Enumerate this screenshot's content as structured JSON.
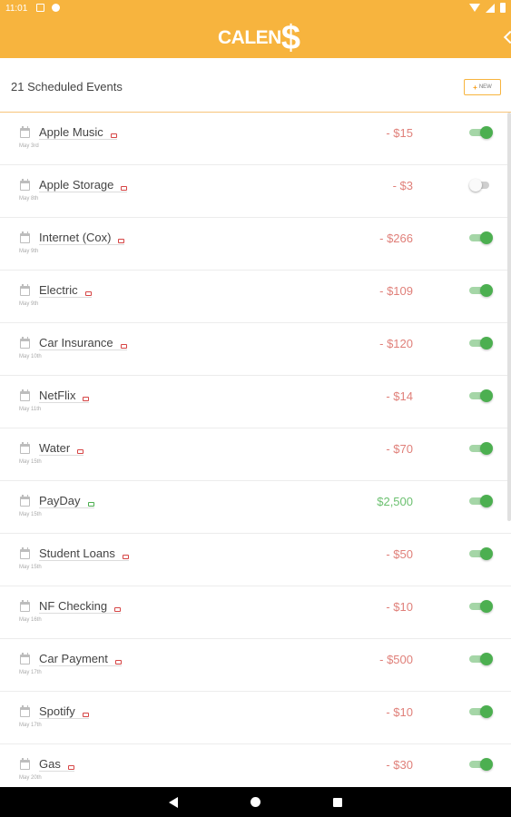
{
  "status_bar": {
    "time": "11:01",
    "icons": [
      "sd-card-icon",
      "play-protect-icon",
      "wifi-icon",
      "signal-icon",
      "battery-icon"
    ]
  },
  "app_bar": {
    "logo_text": "CALEN",
    "logo_symbol": "$",
    "brand_color": "#f7b43e"
  },
  "header": {
    "events_count_label": "21 Scheduled Events",
    "new_button_label": "NEW",
    "new_button_icon": "+"
  },
  "colors": {
    "expense": "#e0807a",
    "income": "#6cc070",
    "toggle_on": "#4caf50"
  },
  "events": [
    {
      "name": "Apple Music",
      "date": "May 3rd",
      "amount": "- $15",
      "type": "expense",
      "enabled": true
    },
    {
      "name": "Apple Storage",
      "date": "May 8th",
      "amount": "- $3",
      "type": "expense",
      "enabled": false
    },
    {
      "name": "Internet (Cox)",
      "date": "May 9th",
      "amount": "- $266",
      "type": "expense",
      "enabled": true
    },
    {
      "name": "Electric",
      "date": "May 9th",
      "amount": "- $109",
      "type": "expense",
      "enabled": true
    },
    {
      "name": "Car Insurance",
      "date": "May 10th",
      "amount": "- $120",
      "type": "expense",
      "enabled": true
    },
    {
      "name": "NetFlix",
      "date": "May 11th",
      "amount": "- $14",
      "type": "expense",
      "enabled": true
    },
    {
      "name": "Water",
      "date": "May 15th",
      "amount": "- $70",
      "type": "expense",
      "enabled": true
    },
    {
      "name": "PayDay",
      "date": "May 15th",
      "amount": "$2,500",
      "type": "income",
      "enabled": true
    },
    {
      "name": "Student Loans",
      "date": "May 15th",
      "amount": "- $50",
      "type": "expense",
      "enabled": true
    },
    {
      "name": "NF Checking",
      "date": "May 16th",
      "amount": "- $10",
      "type": "expense",
      "enabled": true
    },
    {
      "name": "Car Payment",
      "date": "May 17th",
      "amount": "- $500",
      "type": "expense",
      "enabled": true
    },
    {
      "name": "Spotify",
      "date": "May 17th",
      "amount": "- $10",
      "type": "expense",
      "enabled": true
    },
    {
      "name": "Gas",
      "date": "May 20th",
      "amount": "- $30",
      "type": "expense",
      "enabled": true
    }
  ]
}
